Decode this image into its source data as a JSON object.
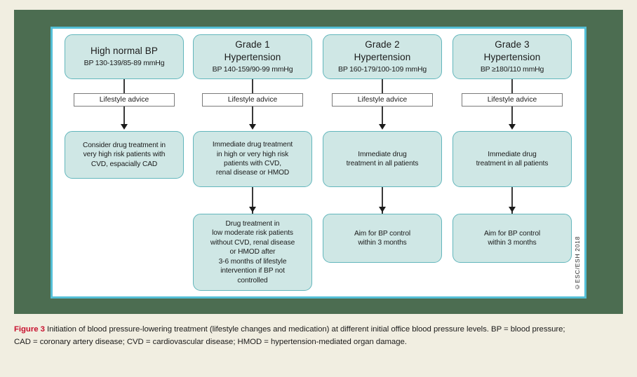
{
  "figure": {
    "label": "Figure 3",
    "caption_part1": "Initiation of blood pressure-lowering treatment (lifestyle changes and medication) at different initial office blood pressure levels. BP =",
    "caption_part2": "blood pressure; CAD = coronary artery disease; CVD = cardiovascular disease; HMOD = hypertension-mediated organ damage.",
    "copyright": "©ESC/ESH 2018"
  },
  "colors": {
    "page_background": "#F1EEE1",
    "frame_green": "#4C6D51",
    "panel_border_cyan": "#54BFD6",
    "node_fill": "#CFE7E5",
    "node_border": "#62B6BC",
    "figure_label_red": "#C8102E"
  },
  "columns": [
    {
      "id": "high-normal-bp",
      "header": {
        "title_line1": "High normal BP",
        "title_line2": "",
        "subtitle": "BP 130-139/85-89 mmHg"
      },
      "advice": "Lifestyle advice",
      "boxes": [
        {
          "id": "consider-drug-treatment",
          "lines": [
            "Consider drug treatment in",
            "very high risk patients with",
            "CVD, espacially CAD"
          ]
        }
      ]
    },
    {
      "id": "grade-1-hypertension",
      "header": {
        "title_line1": "Grade 1",
        "title_line2": "Hypertension",
        "subtitle": "BP 140-159/90-99 mmHg"
      },
      "advice": "Lifestyle advice",
      "boxes": [
        {
          "id": "immediate-drug-treatment-high-risk",
          "lines": [
            "Immediate drug treatment",
            "in high or very high risk",
            "patients with CVD,",
            "renal disease or HMOD"
          ]
        },
        {
          "id": "drug-treatment-low-moderate-risk",
          "lines": [
            "Drug treatment in",
            "low moderate risk patients",
            "without CVD, renal disease",
            "or HMOD after",
            "3-6 months of lifestyle",
            "intervention if BP not",
            "controlled"
          ]
        }
      ]
    },
    {
      "id": "grade-2-hypertension",
      "header": {
        "title_line1": "Grade 2",
        "title_line2": "Hypertension",
        "subtitle": "BP 160-179/100-109 mmHg"
      },
      "advice": "Lifestyle advice",
      "boxes": [
        {
          "id": "immediate-drug-treatment-all",
          "lines": [
            "Immediate drug",
            "treatment in all patients"
          ]
        },
        {
          "id": "aim-bp-control",
          "lines": [
            "Aim for BP control",
            "within 3 months"
          ]
        }
      ]
    },
    {
      "id": "grade-3-hypertension",
      "header": {
        "title_line1": "Grade 3",
        "title_line2": "Hypertension",
        "subtitle": "BP ≥180/110 mmHg"
      },
      "advice": "Lifestyle advice",
      "boxes": [
        {
          "id": "immediate-drug-treatment-all",
          "lines": [
            "Immediate drug",
            "treatment in all patients"
          ]
        },
        {
          "id": "aim-bp-control",
          "lines": [
            "Aim for BP control",
            "within 3 months"
          ]
        }
      ]
    }
  ]
}
